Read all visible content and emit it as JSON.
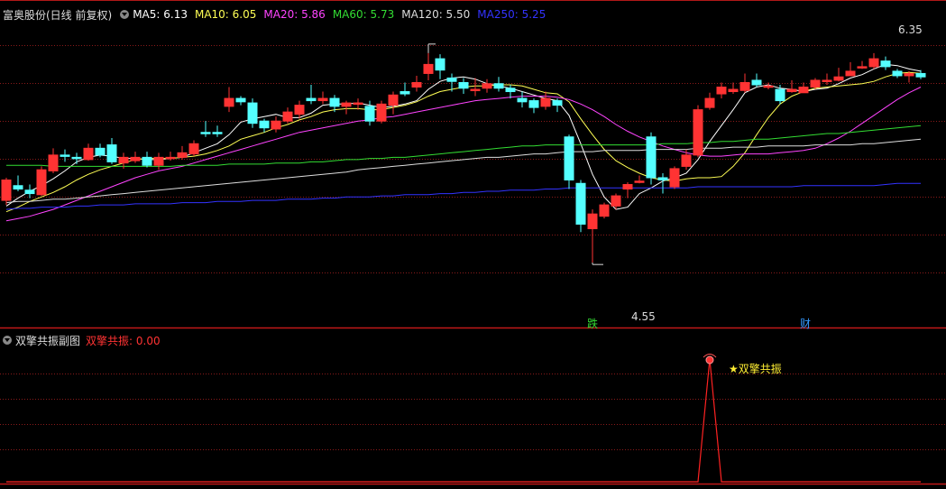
{
  "main_panel": {
    "title": "富奥股份(日线 前复权)",
    "ma_legend": [
      {
        "label": "MA5: 6.13",
        "color": "#ffffff"
      },
      {
        "label": "MA10: 6.05",
        "color": "#ffff55"
      },
      {
        "label": "MA20: 5.86",
        "color": "#ff44ff"
      },
      {
        "label": "MA60: 5.73",
        "color": "#33dd33"
      },
      {
        "label": "MA120: 5.50",
        "color": "#dddddd"
      },
      {
        "label": "MA250: 5.25",
        "color": "#3333ff"
      }
    ],
    "high_label": "6.35",
    "low_label": "4.55",
    "event_tags": [
      "跌",
      "财"
    ]
  },
  "sub_panel": {
    "title": "双擎共振副图",
    "value_label": "双擎共振: 0.00",
    "signal_label": "双擎共振"
  },
  "chart_data": {
    "type": "candlestick",
    "title": "富奥股份(日线 前复权)",
    "ylim": [
      4.4,
      6.55
    ],
    "colors": {
      "up": "#ff3333",
      "down": "#54ffff",
      "grid": "#8a1a1a"
    },
    "candles": [
      [
        5.1,
        5.28,
        5.3,
        5.06
      ],
      [
        5.23,
        5.2,
        5.32,
        5.18
      ],
      [
        5.19,
        5.16,
        5.24,
        5.12
      ],
      [
        5.15,
        5.37,
        5.4,
        5.14
      ],
      [
        5.36,
        5.5,
        5.56,
        5.34
      ],
      [
        5.5,
        5.49,
        5.55,
        5.44
      ],
      [
        5.48,
        5.47,
        5.52,
        5.42
      ],
      [
        5.46,
        5.56,
        5.6,
        5.45
      ],
      [
        5.56,
        5.5,
        5.6,
        5.48
      ],
      [
        5.59,
        5.44,
        5.65,
        5.42
      ],
      [
        5.43,
        5.48,
        5.52,
        5.38
      ],
      [
        5.45,
        5.48,
        5.53,
        5.43
      ],
      [
        5.48,
        5.41,
        5.53,
        5.39
      ],
      [
        5.41,
        5.48,
        5.52,
        5.37
      ],
      [
        5.48,
        5.48,
        5.53,
        5.45
      ],
      [
        5.48,
        5.52,
        5.58,
        5.46
      ],
      [
        5.51,
        5.6,
        5.63,
        5.49
      ],
      [
        5.7,
        5.69,
        5.8,
        5.66
      ],
      [
        5.7,
        5.69,
        5.76,
        5.66
      ],
      [
        5.93,
        6.0,
        6.1,
        5.88
      ],
      [
        6.0,
        5.97,
        6.02,
        5.94
      ],
      [
        5.96,
        5.78,
        6.0,
        5.74
      ],
      [
        5.8,
        5.74,
        5.82,
        5.7
      ],
      [
        5.73,
        5.8,
        5.84,
        5.7
      ],
      [
        5.8,
        5.88,
        5.92,
        5.78
      ],
      [
        5.86,
        5.94,
        5.98,
        5.82
      ],
      [
        6.0,
        5.98,
        6.12,
        5.95
      ],
      [
        5.98,
        6.0,
        6.06,
        5.95
      ],
      [
        6.0,
        5.93,
        6.03,
        5.88
      ],
      [
        5.93,
        5.96,
        5.98,
        5.86
      ],
      [
        5.96,
        5.96,
        6.0,
        5.9
      ],
      [
        5.93,
        5.8,
        5.98,
        5.76
      ],
      [
        5.8,
        5.95,
        5.98,
        5.78
      ],
      [
        5.94,
        6.03,
        6.06,
        5.86
      ],
      [
        6.06,
        6.04,
        6.14,
        6.02
      ],
      [
        6.1,
        6.14,
        6.2,
        6.06
      ],
      [
        6.22,
        6.3,
        6.4,
        6.16
      ],
      [
        6.35,
        6.25,
        6.39,
        6.17
      ],
      [
        6.18,
        6.15,
        6.22,
        6.06
      ],
      [
        6.14,
        6.09,
        6.18,
        6.04
      ],
      [
        6.08,
        6.08,
        6.18,
        6.02
      ],
      [
        6.09,
        6.13,
        6.17,
        6.05
      ],
      [
        6.13,
        6.09,
        6.19,
        6.06
      ],
      [
        6.09,
        6.06,
        6.12,
        6.0
      ],
      [
        6.0,
        5.97,
        6.06,
        5.92
      ],
      [
        5.98,
        5.92,
        6.0,
        5.87
      ],
      [
        5.93,
        6.0,
        6.06,
        5.9
      ],
      [
        5.98,
        5.94,
        6.0,
        5.88
      ],
      [
        5.66,
        5.28,
        5.68,
        5.2
      ],
      [
        5.25,
        4.89,
        5.28,
        4.82
      ],
      [
        4.85,
        4.98,
        5.02,
        4.55
      ],
      [
        4.96,
        5.06,
        5.08,
        4.94
      ],
      [
        5.05,
        5.14,
        5.16,
        5.02
      ],
      [
        5.2,
        5.24,
        5.26,
        5.12
      ],
      [
        5.27,
        5.27,
        5.32,
        5.25
      ],
      [
        5.66,
        5.3,
        5.7,
        5.24
      ],
      [
        5.3,
        5.28,
        5.34,
        5.16
      ],
      [
        5.22,
        5.38,
        5.4,
        5.2
      ],
      [
        5.4,
        5.5,
        5.55,
        5.37
      ],
      [
        5.5,
        5.9,
        5.94,
        5.48
      ],
      [
        5.92,
        6.0,
        6.05,
        5.9
      ],
      [
        6.04,
        6.1,
        6.14,
        6.0
      ],
      [
        6.06,
        6.08,
        6.14,
        6.04
      ],
      [
        6.07,
        6.14,
        6.22,
        6.05
      ],
      [
        6.16,
        6.12,
        6.22,
        6.1
      ],
      [
        6.1,
        6.11,
        6.14,
        6.08
      ],
      [
        6.08,
        5.98,
        6.12,
        5.95
      ],
      [
        6.06,
        6.08,
        6.16,
        6.05
      ],
      [
        6.05,
        6.1,
        6.14,
        6.05
      ],
      [
        6.1,
        6.16,
        6.18,
        6.08
      ],
      [
        6.16,
        6.16,
        6.22,
        6.12
      ],
      [
        6.16,
        6.19,
        6.27,
        6.15
      ],
      [
        6.2,
        6.24,
        6.32,
        6.2
      ],
      [
        6.28,
        6.28,
        6.33,
        6.26
      ],
      [
        6.28,
        6.35,
        6.4,
        6.26
      ],
      [
        6.33,
        6.28,
        6.37,
        6.25
      ],
      [
        6.24,
        6.2,
        6.26,
        6.18
      ],
      [
        6.2,
        6.22,
        6.24,
        6.14
      ],
      [
        6.22,
        6.19,
        6.25,
        6.17
      ]
    ],
    "moving_averages": [
      {
        "name": "MA5",
        "color": "#ffffff",
        "values": [
          5.05,
          5.12,
          5.18,
          5.23,
          5.29,
          5.36,
          5.44,
          5.48,
          5.5,
          5.49,
          5.47,
          5.47,
          5.46,
          5.46,
          5.47,
          5.48,
          5.52,
          5.56,
          5.6,
          5.68,
          5.79,
          5.82,
          5.84,
          5.86,
          5.83,
          5.83,
          5.87,
          5.94,
          5.95,
          5.95,
          5.96,
          5.94,
          5.92,
          5.93,
          5.95,
          5.98,
          6.08,
          6.15,
          6.18,
          6.19,
          6.17,
          6.13,
          6.11,
          6.09,
          6.06,
          6.03,
          6.0,
          5.98,
          5.85,
          5.6,
          5.33,
          5.13,
          5.02,
          5.04,
          5.16,
          5.21,
          5.27,
          5.3,
          5.34,
          5.46,
          5.62,
          5.76,
          5.9,
          6.05,
          6.1,
          6.12,
          6.09,
          6.08,
          6.06,
          6.08,
          6.09,
          6.13,
          6.18,
          6.21,
          6.26,
          6.3,
          6.29,
          6.26,
          6.24
        ]
      },
      {
        "name": "MA10",
        "color": "#ffff55",
        "values": [
          5.0,
          5.04,
          5.09,
          5.13,
          5.17,
          5.22,
          5.28,
          5.33,
          5.37,
          5.4,
          5.43,
          5.46,
          5.47,
          5.47,
          5.47,
          5.48,
          5.49,
          5.51,
          5.54,
          5.58,
          5.64,
          5.67,
          5.7,
          5.74,
          5.77,
          5.81,
          5.84,
          5.88,
          5.9,
          5.91,
          5.91,
          5.9,
          5.9,
          5.92,
          5.94,
          5.97,
          6.02,
          6.06,
          6.08,
          6.1,
          6.11,
          6.11,
          6.12,
          6.12,
          6.11,
          6.08,
          6.05,
          6.04,
          5.97,
          5.82,
          5.68,
          5.55,
          5.45,
          5.39,
          5.34,
          5.3,
          5.28,
          5.27,
          5.29,
          5.3,
          5.3,
          5.31,
          5.4,
          5.52,
          5.68,
          5.83,
          5.95,
          6.02,
          6.06,
          6.09,
          6.1,
          6.11,
          6.12,
          6.13,
          6.15,
          6.19,
          6.22,
          6.23,
          6.22
        ]
      },
      {
        "name": "MA20",
        "color": "#ff44ff",
        "values": [
          4.92,
          4.94,
          4.96,
          4.99,
          5.02,
          5.06,
          5.1,
          5.14,
          5.18,
          5.22,
          5.26,
          5.3,
          5.33,
          5.36,
          5.38,
          5.4,
          5.43,
          5.46,
          5.49,
          5.52,
          5.55,
          5.58,
          5.61,
          5.64,
          5.67,
          5.7,
          5.72,
          5.74,
          5.76,
          5.78,
          5.8,
          5.81,
          5.83,
          5.84,
          5.86,
          5.88,
          5.9,
          5.92,
          5.94,
          5.96,
          5.98,
          5.99,
          6.0,
          6.01,
          6.02,
          6.02,
          6.02,
          6.01,
          5.99,
          5.95,
          5.9,
          5.84,
          5.77,
          5.71,
          5.66,
          5.62,
          5.58,
          5.55,
          5.52,
          5.5,
          5.49,
          5.49,
          5.5,
          5.51,
          5.51,
          5.51,
          5.52,
          5.53,
          5.54,
          5.56,
          5.6,
          5.65,
          5.71,
          5.78,
          5.85,
          5.92,
          5.99,
          6.05,
          6.1
        ]
      },
      {
        "name": "MA60",
        "color": "#33dd33",
        "values": [
          5.41,
          5.41,
          5.41,
          5.41,
          5.4,
          5.4,
          5.4,
          5.4,
          5.4,
          5.4,
          5.4,
          5.4,
          5.4,
          5.4,
          5.4,
          5.41,
          5.41,
          5.41,
          5.41,
          5.42,
          5.42,
          5.42,
          5.42,
          5.43,
          5.43,
          5.43,
          5.44,
          5.44,
          5.45,
          5.46,
          5.46,
          5.47,
          5.47,
          5.48,
          5.48,
          5.49,
          5.5,
          5.51,
          5.52,
          5.53,
          5.54,
          5.55,
          5.56,
          5.57,
          5.58,
          5.58,
          5.59,
          5.59,
          5.59,
          5.59,
          5.59,
          5.59,
          5.59,
          5.59,
          5.59,
          5.59,
          5.6,
          5.6,
          5.6,
          5.61,
          5.61,
          5.62,
          5.62,
          5.63,
          5.64,
          5.64,
          5.65,
          5.66,
          5.67,
          5.68,
          5.69,
          5.69,
          5.7,
          5.71,
          5.72,
          5.73,
          5.74,
          5.75,
          5.76
        ]
      },
      {
        "name": "MA120",
        "color": "#dddddd",
        "values": [
          5.08,
          5.09,
          5.09,
          5.1,
          5.11,
          5.11,
          5.12,
          5.13,
          5.14,
          5.15,
          5.16,
          5.17,
          5.18,
          5.19,
          5.2,
          5.21,
          5.22,
          5.23,
          5.24,
          5.25,
          5.26,
          5.27,
          5.28,
          5.29,
          5.3,
          5.31,
          5.32,
          5.33,
          5.34,
          5.35,
          5.37,
          5.38,
          5.39,
          5.4,
          5.41,
          5.42,
          5.43,
          5.44,
          5.45,
          5.46,
          5.47,
          5.48,
          5.48,
          5.49,
          5.5,
          5.51,
          5.51,
          5.52,
          5.53,
          5.53,
          5.53,
          5.54,
          5.54,
          5.54,
          5.54,
          5.55,
          5.55,
          5.55,
          5.55,
          5.56,
          5.56,
          5.56,
          5.57,
          5.57,
          5.57,
          5.58,
          5.58,
          5.58,
          5.58,
          5.59,
          5.59,
          5.59,
          5.59,
          5.6,
          5.6,
          5.61,
          5.62,
          5.63,
          5.64
        ]
      },
      {
        "name": "MA250",
        "color": "#3333ff",
        "values": [
          5.02,
          5.03,
          5.03,
          5.04,
          5.04,
          5.04,
          5.05,
          5.05,
          5.06,
          5.06,
          5.06,
          5.07,
          5.07,
          5.07,
          5.07,
          5.08,
          5.08,
          5.08,
          5.09,
          5.09,
          5.09,
          5.1,
          5.1,
          5.1,
          5.11,
          5.11,
          5.11,
          5.12,
          5.12,
          5.13,
          5.13,
          5.13,
          5.14,
          5.14,
          5.15,
          5.15,
          5.15,
          5.16,
          5.16,
          5.17,
          5.17,
          5.18,
          5.18,
          5.19,
          5.19,
          5.19,
          5.2,
          5.2,
          5.21,
          5.21,
          5.21,
          5.21,
          5.21,
          5.21,
          5.21,
          5.21,
          5.21,
          5.21,
          5.21,
          5.22,
          5.22,
          5.22,
          5.22,
          5.22,
          5.22,
          5.22,
          5.22,
          5.22,
          5.23,
          5.23,
          5.23,
          5.23,
          5.23,
          5.23,
          5.23,
          5.24,
          5.25,
          5.25,
          5.25
        ]
      }
    ],
    "sub_indicator": {
      "name": "双擎共振",
      "values": [
        0,
        0,
        0,
        0,
        0,
        0,
        0,
        0,
        0,
        0,
        0,
        0,
        0,
        0,
        0,
        0,
        0,
        0,
        0,
        0,
        0,
        0,
        0,
        0,
        0,
        0,
        0,
        0,
        0,
        0,
        0,
        0,
        0,
        0,
        0,
        0,
        0,
        0,
        0,
        0,
        0,
        0,
        0,
        0,
        0,
        0,
        0,
        0,
        0,
        0,
        0,
        0,
        0,
        0,
        0,
        0,
        0,
        0,
        0,
        0,
        1,
        0,
        0,
        0,
        0,
        0,
        0,
        0,
        0,
        0,
        0,
        0,
        0,
        0,
        0,
        0,
        0,
        0,
        0
      ],
      "ylim": [
        0,
        1
      ],
      "color": "#ff2222"
    }
  }
}
